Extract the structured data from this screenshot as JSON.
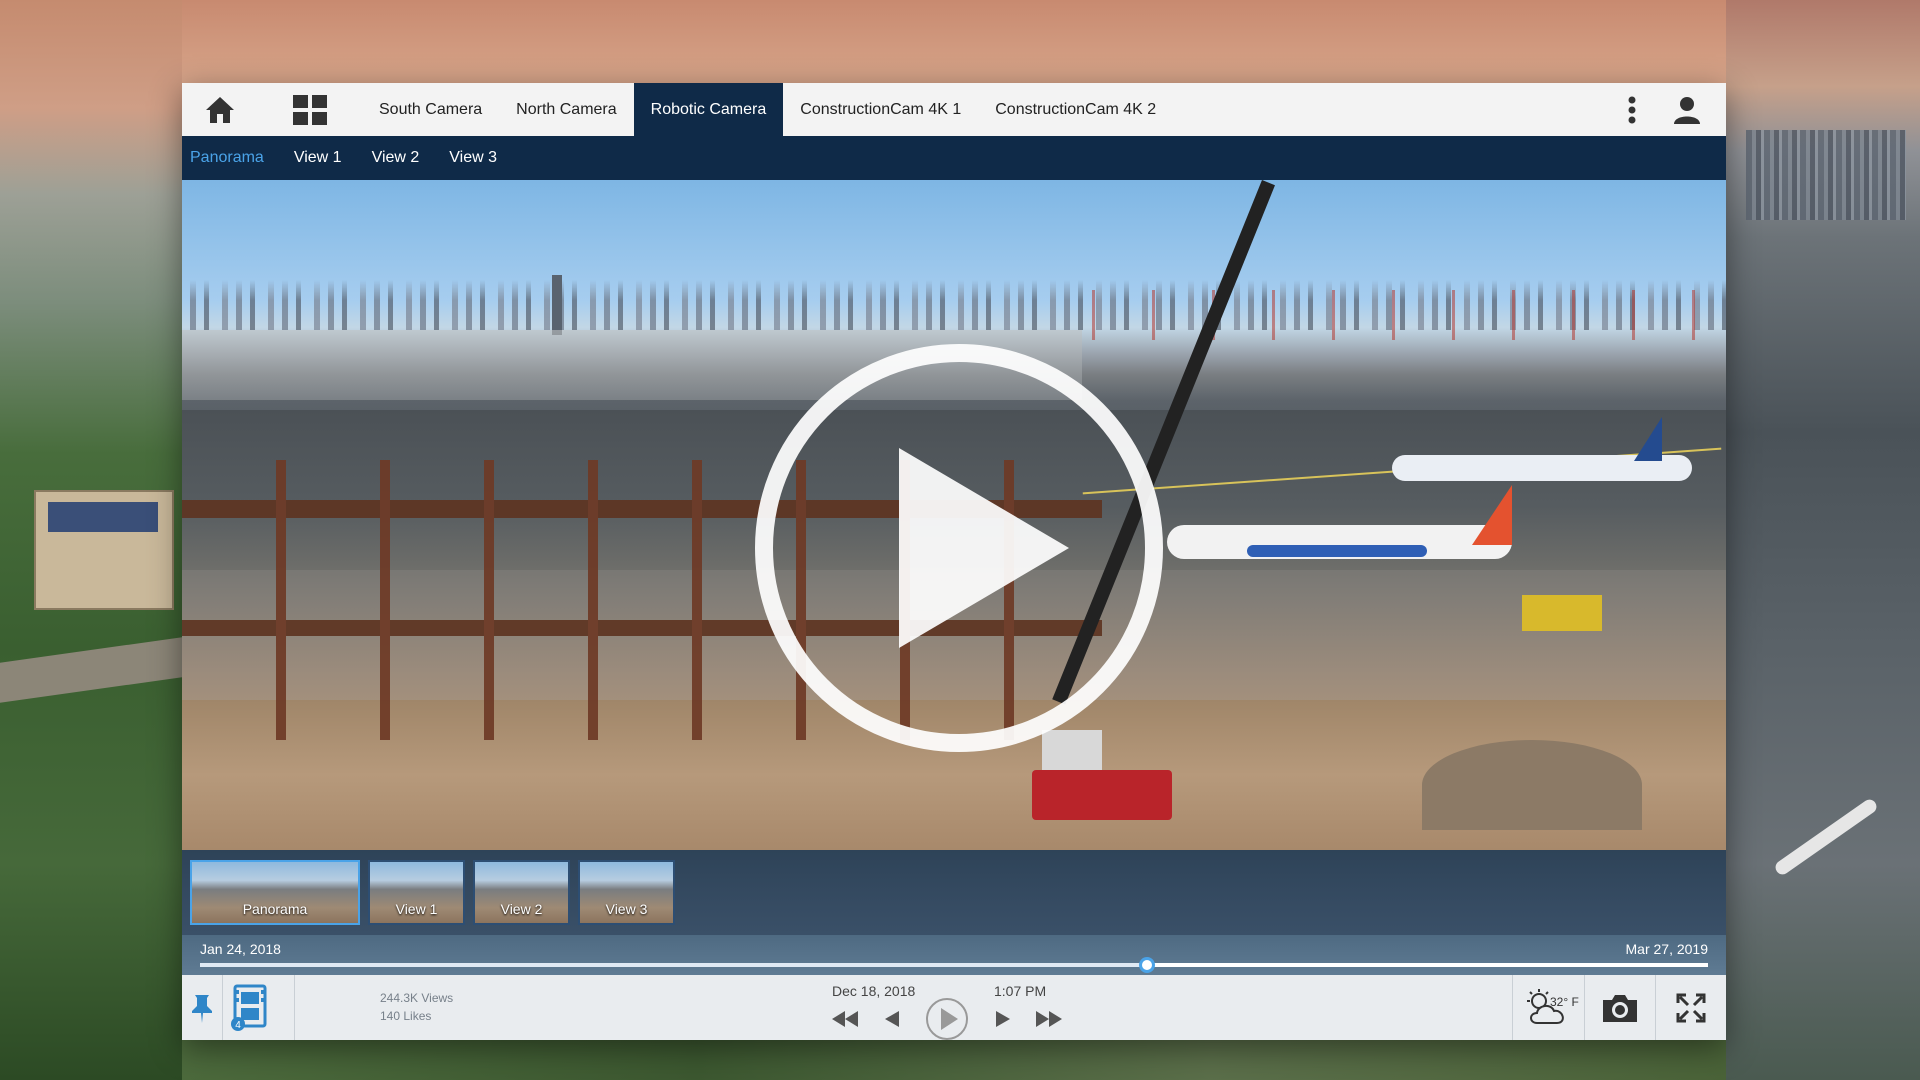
{
  "topbar": {
    "camera_tabs": [
      {
        "label": "South Camera",
        "active": false
      },
      {
        "label": "North Camera",
        "active": false
      },
      {
        "label": "Robotic Camera",
        "active": true
      },
      {
        "label": "ConstructionCam 4K 1",
        "active": false
      },
      {
        "label": "ConstructionCam 4K 2",
        "active": false
      }
    ]
  },
  "view_tabs": [
    {
      "label": "Panorama",
      "active": true
    },
    {
      "label": "View 1",
      "active": false
    },
    {
      "label": "View 2",
      "active": false
    },
    {
      "label": "View 3",
      "active": false
    }
  ],
  "thumbnails": [
    {
      "label": "Panorama",
      "active": true
    },
    {
      "label": "View 1",
      "active": false
    },
    {
      "label": "View 2",
      "active": false
    },
    {
      "label": "View 3",
      "active": false
    }
  ],
  "timeline": {
    "start_date": "Jan 24, 2018",
    "end_date": "Mar 27, 2019",
    "position_fraction": 0.628
  },
  "controls": {
    "views": "244.3K Views",
    "likes": "140 Likes",
    "current_date": "Dec 18, 2018",
    "current_time": "1:07 PM",
    "temperature": "32° F",
    "film_badge": "4"
  },
  "colors": {
    "navy": "#0f2a48",
    "accent_blue": "#4aa3e8",
    "control_bg": "#e9ecef"
  },
  "icons": [
    "home-icon",
    "grid-icon",
    "more-vertical-icon",
    "user-icon",
    "pin-icon",
    "film-icon",
    "rewind-icon",
    "step-back-icon",
    "play-icon",
    "step-forward-icon",
    "fast-forward-icon",
    "weather-icon",
    "camera-icon",
    "fullscreen-icon"
  ]
}
